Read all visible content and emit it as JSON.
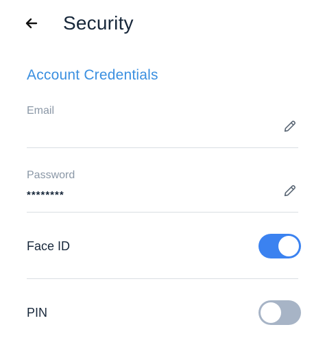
{
  "header": {
    "title": "Security",
    "back_icon": "arrow-left-icon"
  },
  "section": {
    "title": "Account Credentials"
  },
  "fields": {
    "email": {
      "label": "Email",
      "value": "",
      "edit_icon": "pencil-icon"
    },
    "password": {
      "label": "Password",
      "value": "********",
      "edit_icon": "pencil-icon"
    }
  },
  "toggles": {
    "face_id": {
      "label": "Face ID",
      "on": true
    },
    "pin": {
      "label": "PIN",
      "on": false
    }
  },
  "colors": {
    "accent": "#3a8fe0",
    "switch_on": "#3b82f0",
    "switch_off": "#a7b4c6",
    "label_muted": "#8a97a6",
    "text_dark": "#17273a"
  }
}
